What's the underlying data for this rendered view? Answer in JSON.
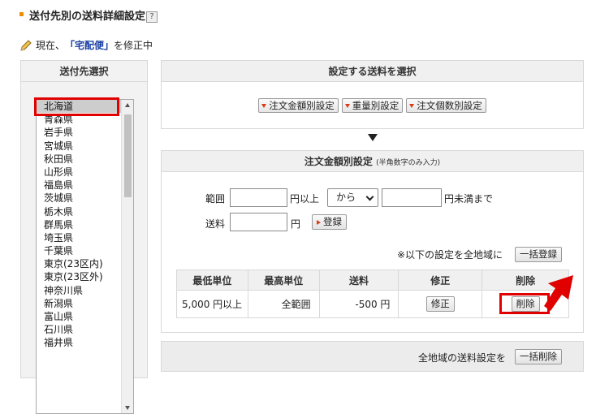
{
  "header": {
    "section_title": "送付先別の送料詳細設定",
    "help_label": "?",
    "current_prefix": "現在、",
    "current_name": "「宅配便」",
    "current_suffix": "を修正中"
  },
  "left_panel": {
    "title": "送付先選択",
    "prefectures": [
      "北海道",
      "青森県",
      "岩手県",
      "宮城県",
      "秋田県",
      "山形県",
      "福島県",
      "茨城県",
      "栃木県",
      "群馬県",
      "埼玉県",
      "千葉県",
      "東京(23区内)",
      "東京(23区外)",
      "神奈川県",
      "新潟県",
      "富山県",
      "石川県",
      "福井県"
    ],
    "selected": "北海道"
  },
  "fee_type": {
    "title": "設定する送料を選択",
    "buttons": [
      "注文金額別設定",
      "重量別設定",
      "注文個数別設定"
    ]
  },
  "order_amount": {
    "title": "注文金額別設定",
    "note": "(半角数字のみ入力)",
    "range_label": "範囲",
    "yen_above": "円以上",
    "from_option": "から",
    "yen_below": "円未満まで",
    "fee_label": "送料",
    "yen": "円",
    "register_button": "登録",
    "bulk_note": "※以下の設定を全地域に",
    "bulk_register_button": "一括登録",
    "table": {
      "headers": [
        "最低単位",
        "最高単位",
        "送料",
        "修正",
        "削除"
      ],
      "rows": [
        {
          "min": "5,000 円以上",
          "max": "全範囲",
          "fee": "-500 円",
          "edit": "修正",
          "delete": "削除"
        }
      ]
    }
  },
  "bottom": {
    "label": "全地域の送料設定を",
    "bulk_delete_button": "一括削除"
  },
  "colors": {
    "accent_orange": "#f08c00",
    "highlight_red": "#e00000",
    "link_blue": "#1a3fa3",
    "button_marker": "#d93c14"
  }
}
